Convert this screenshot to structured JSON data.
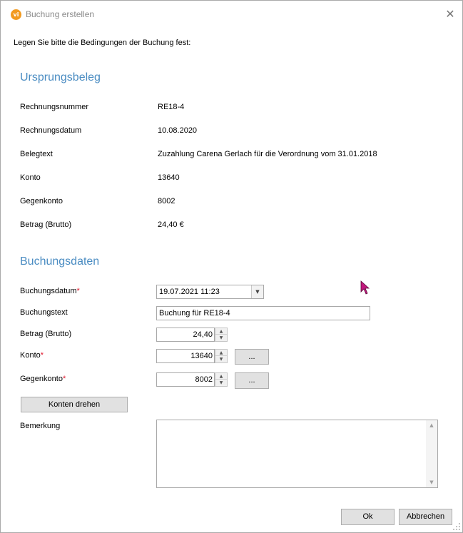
{
  "window": {
    "title": "Buchung erstellen",
    "app_icon_text": "vi",
    "close_glyph": "✕"
  },
  "intro": "Legen Sie bitte die Bedingungen der Buchung fest:",
  "ursprungsbeleg": {
    "heading": "Ursprungsbeleg",
    "rows": [
      {
        "label": "Rechnungsnummer",
        "value": "RE18-4"
      },
      {
        "label": "Rechnungsdatum",
        "value": "10.08.2020"
      },
      {
        "label": "Belegtext",
        "value": "Zuzahlung Carena Gerlach für die Verordnung vom 31.01.2018"
      },
      {
        "label": "Konto",
        "value": "13640"
      },
      {
        "label": "Gegenkonto",
        "value": "8002"
      },
      {
        "label": "Betrag (Brutto)",
        "value": "24,40 €"
      }
    ]
  },
  "buchungsdaten": {
    "heading": "Buchungsdaten",
    "required_marker": "*",
    "buchungsdatum": {
      "label": "Buchungsdatum",
      "value": "19.07.2021 11:23"
    },
    "buchungstext": {
      "label": "Buchungstext",
      "value": "Buchung für RE18-4"
    },
    "betrag": {
      "label": "Betrag (Brutto)",
      "value": "24,40"
    },
    "konto": {
      "label": "Konto",
      "value": "13640",
      "browse_label": "..."
    },
    "gegenkonto": {
      "label": "Gegenkonto",
      "value": "8002",
      "browse_label": "..."
    },
    "konten_drehen_label": "Konten drehen",
    "bemerkung": {
      "label": "Bemerkung",
      "value": ""
    }
  },
  "footer": {
    "ok_label": "Ok",
    "cancel_label": "Abbrechen"
  },
  "icons": {
    "dropdown": "chevron-down-icon",
    "spin_up": "spin-up-icon",
    "spin_down": "spin-down-icon",
    "cursor": "pointer-cursor-icon",
    "resize": "resize-grip-icon"
  },
  "colors": {
    "section_heading": "#4a8cc2",
    "required": "#e0162b",
    "app_icon": "#f29a1e",
    "cursor": "#c2187e"
  }
}
